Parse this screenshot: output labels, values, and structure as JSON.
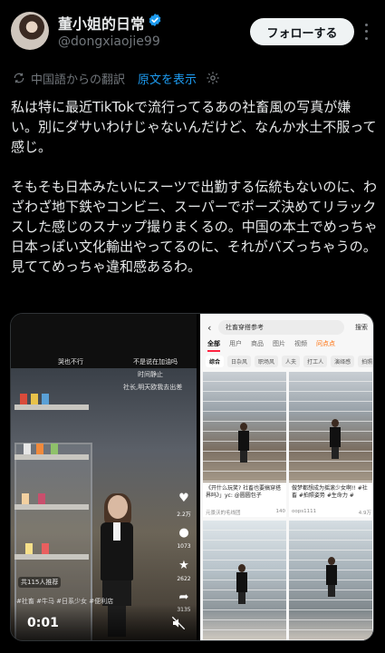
{
  "profile": {
    "display_name": "董小姐的日常",
    "username": "@dongxiaojie99",
    "follow_label": "フォローする"
  },
  "translation": {
    "note": "中国語からの翻訳",
    "show_original": "原文を表示"
  },
  "tweet": {
    "paragraph_1": "私は特に最近TikTokで流行ってるあの社畜風の写真が嫌い。別にダサいわけじゃないんだけど、なんか水土不服って感じ。",
    "paragraph_2": "そもそも日本みたいにスーツで出勤する伝統もないのに、わざわざ地下鉄やコンビニ、スーパーでポーズ決めてリラックスした感じのスナップ撮りまくるの。中国の本土でめっちゃ日本っぽい文化輸出やってるのに、それがバズっちゃうの。見ててめっちゃ違和感あるわ。"
  },
  "video": {
    "caption_1": "哭也不行",
    "caption_2": "不是说在加油吗",
    "caption_3": "时间静止",
    "caption_4": "社长,明天欧我去出差",
    "likes": "2.2万",
    "comments": "1073",
    "favorites": "2622",
    "shares": "3135",
    "recommend": "共115人推荐",
    "tags": "#社畜 #牛马 #日系少女 #便利店",
    "timecode": "0:01"
  },
  "search_screen": {
    "query": "社畜穿搭参考",
    "search_button": "搜索",
    "tabs": [
      "全部",
      "用户",
      "商品",
      "图片",
      "视频"
    ],
    "live_tab": "问点点",
    "chips": [
      "综合",
      "日杂风",
      "职场风",
      "人夫",
      "打工人",
      "演绎感",
      "拍照"
    ],
    "cards": [
      {
        "title": "《开什么玩笑? 社畜也要搞穿搭界吗》」yc: @圆圆包子",
        "author": "元景沃的毛线团",
        "likes": "140"
      },
      {
        "title": "做梦都想成为摇滚少女啊!! #社畜 #拍照姿势 #生命力 #",
        "author": "oops1111",
        "likes": "4.9万"
      }
    ]
  },
  "colors": {
    "accent": "#1d9bf0",
    "text": "#e7e9ea",
    "muted": "#71767b",
    "background": "#000000"
  }
}
